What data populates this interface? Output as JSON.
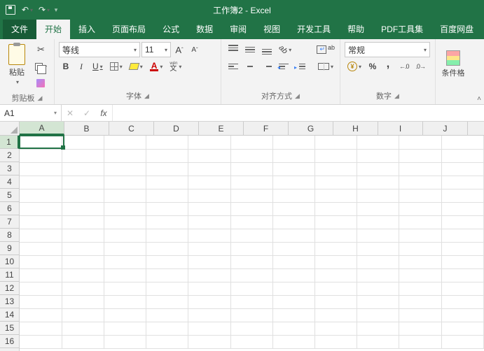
{
  "title": "工作簿2 - Excel",
  "qat": {
    "undo": "↶",
    "redo": "↷"
  },
  "tabs": {
    "file": "文件",
    "home": "开始",
    "insert": "插入",
    "pageLayout": "页面布局",
    "formulas": "公式",
    "data": "数据",
    "review": "审阅",
    "view": "视图",
    "developer": "开发工具",
    "help": "帮助",
    "pdf": "PDF工具集",
    "baidu": "百度网盘"
  },
  "clipboard": {
    "paste": "粘贴",
    "label": "剪贴板"
  },
  "font": {
    "name": "等线",
    "size": "11",
    "bold": "B",
    "italic": "I",
    "underline": "U",
    "increase": "A",
    "decrease": "A",
    "ruby": "文",
    "colorA": "A",
    "label": "字体"
  },
  "alignment": {
    "orientA": "ab",
    "wrap": "ab",
    "merge": " ",
    "label": "对齐方式"
  },
  "number": {
    "format": "常规",
    "decInc": ".0 .00",
    "decDec": ".00 .0",
    "label": "数字"
  },
  "styles": {
    "cf": "条件格"
  },
  "cellRef": "A1",
  "fxCancel": "✕",
  "fxEnter": "✓",
  "fxIcon": "fx",
  "formula": "",
  "columns": [
    "A",
    "B",
    "C",
    "D",
    "E",
    "F",
    "G",
    "H",
    "I",
    "J"
  ],
  "rows": [
    "1",
    "2",
    "3",
    "4",
    "5",
    "6",
    "7",
    "8",
    "9",
    "10",
    "11",
    "12",
    "13",
    "14",
    "15",
    "16"
  ],
  "selectedCol": 0,
  "selectedRow": 0
}
